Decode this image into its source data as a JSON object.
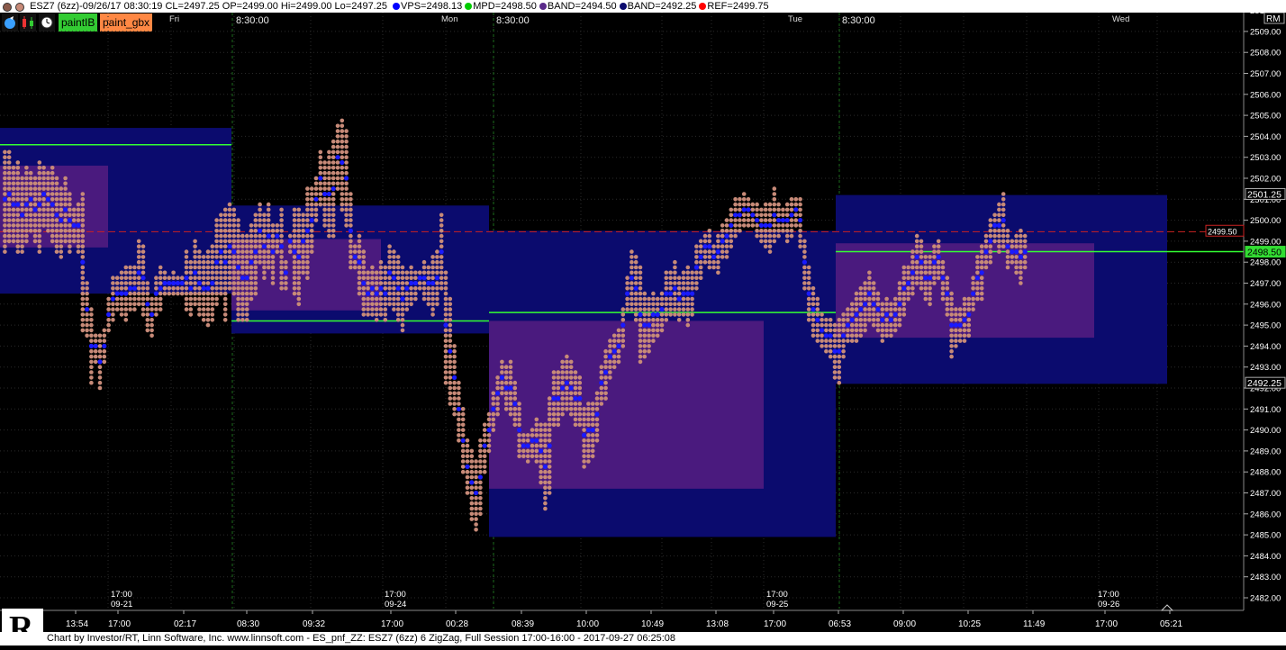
{
  "header": {
    "symbol_line": "ESZ7 (6zz)-09/26/17 08:30:19 CL=2497.25 OP=2499.00 Hi=2499.00 Lo=2497.25",
    "legend": [
      {
        "label": "VPS=2498.13",
        "color": "#0000ff"
      },
      {
        "label": "MPD=2498.50",
        "color": "#00cc00"
      },
      {
        "label": "BAND=2494.50",
        "color": "#5a2a8a"
      },
      {
        "label": "BAND=2492.25",
        "color": "#0b0b6e"
      },
      {
        "label": "REF=2499.75",
        "color": "#ff0000"
      }
    ]
  },
  "toolbar": {
    "paint_ib": "paintIB",
    "paint_gbx": "paint_gbx",
    "rm": "RM"
  },
  "footer": {
    "text": "Chart by Investor/RT, Linn Software, Inc. www.linnsoft.com - ES_pnf_ZZ: ESZ7 (6zz) 6 ZigZag, Full Session 17:00-16:00 - 2017-09-27 06:25:08"
  },
  "colors": {
    "dot": "#c78a78",
    "blue_dot": "#1a1aff",
    "band_outer": "#0b0b6e",
    "band_inner": "#4a1a7e",
    "mpd_line": "#33ff33",
    "ref_line": "#cc2222",
    "grid": "#2a2a2a",
    "session_line": "#1c6b1c"
  },
  "chart_data": {
    "type": "point-and-figure",
    "y_range": [
      2481.5,
      2510.5
    ],
    "y_ticks": [
      "2482.00",
      "2483.00",
      "2484.00",
      "2485.00",
      "2486.00",
      "2487.00",
      "2488.00",
      "2489.00",
      "2490.00",
      "2491.00",
      "2492.00",
      "2493.00",
      "2494.00",
      "2495.00",
      "2496.00",
      "2497.00",
      "2498.00",
      "2499.00",
      "2500.00",
      "2501.00",
      "2502.00",
      "2503.00",
      "2504.00",
      "2505.00",
      "2506.00",
      "2507.00",
      "2508.00",
      "2509.00",
      "2510.00"
    ],
    "price_markers": [
      {
        "label": "2501.25",
        "value": 2501.25,
        "style": "white"
      },
      {
        "label": "2499.50",
        "value": 2499.5,
        "style": "red"
      },
      {
        "label": "2498.50",
        "value": 2498.5,
        "style": "green"
      },
      {
        "label": "2492.25",
        "value": 2492.25,
        "style": "white"
      }
    ],
    "ref_line": 2499.45,
    "day_labels": [
      "Fri",
      "Mon",
      "Tue",
      "Wed"
    ],
    "session_times": [
      "8:30:00",
      "8:30:00",
      "8:30:00"
    ],
    "date_marks": [
      {
        "time": "17:00",
        "date": "09-21"
      },
      {
        "time": "17:00",
        "date": "09-24"
      },
      {
        "time": "17:00",
        "date": "09-25"
      },
      {
        "time": "17:00",
        "date": "09-26"
      }
    ],
    "x_ticks": [
      "13:54",
      "17:00",
      "02:17",
      "08:30",
      "09:32",
      "17:00",
      "00:28",
      "08:39",
      "10:00",
      "10:49",
      "13:08",
      "17:00",
      "06:53",
      "09:00",
      "10:25",
      "11:49",
      "17:00",
      "05:21"
    ],
    "bands": [
      {
        "session": 1,
        "outer": [
          2496.5,
          2504.4
        ],
        "inner": [
          2498.7,
          2502.6
        ],
        "mpd": 2503.6
      },
      {
        "session": 2,
        "outer": [
          2494.6,
          2500.7
        ],
        "inner": [
          2495.7,
          2499.1
        ],
        "mpd": 2495.2
      },
      {
        "session": 3,
        "outer": [
          2484.9,
          2499.5
        ],
        "inner": [
          2487.2,
          2495.2
        ],
        "mpd": 2495.6
      },
      {
        "session": 4,
        "outer": [
          2492.2,
          2501.2
        ],
        "inner": [
          2494.4,
          2498.9
        ],
        "mpd": 2498.5
      }
    ],
    "columns": [
      [
        2498.5,
        2503.25
      ],
      [
        2499,
        2503.25
      ],
      [
        2499,
        2502.5
      ],
      [
        2498.5,
        2502.75
      ],
      [
        2498.5,
        2502
      ],
      [
        2499,
        2502.5
      ],
      [
        2499.5,
        2502.25
      ],
      [
        2499,
        2502
      ],
      [
        2498.5,
        2502.75
      ],
      [
        2499.75,
        2502.5
      ],
      [
        2499.5,
        2502.25
      ],
      [
        2499,
        2502.5
      ],
      [
        2498.5,
        2502
      ],
      [
        2498.25,
        2501.5
      ],
      [
        2499,
        2502
      ],
      [
        2498.5,
        2501.25
      ],
      [
        2499,
        2500.5
      ],
      [
        2498.5,
        2500.75
      ],
      [
        2494.75,
        2501.25
      ],
      [
        2494.5,
        2497
      ],
      [
        2492.25,
        2495.75
      ],
      [
        2493.25,
        2494.5
      ],
      [
        2492,
        2494.5
      ],
      [
        2493.25,
        2494.75
      ],
      [
        2494.75,
        2496.25
      ],
      [
        2495.25,
        2497.25
      ],
      [
        2495.75,
        2497.25
      ],
      [
        2495.5,
        2497.5
      ],
      [
        2495.25,
        2497.75
      ],
      [
        2495.75,
        2497.75
      ],
      [
        2495.75,
        2497.75
      ],
      [
        2496,
        2499
      ],
      [
        2495.5,
        2498.75
      ],
      [
        2494.75,
        2497
      ],
      [
        2494.5,
        2496.25
      ],
      [
        2495.5,
        2497.25
      ],
      [
        2495.75,
        2497.75
      ],
      [
        2496.5,
        2497.5
      ],
      [
        2496.5,
        2497.25
      ],
      [
        2496.5,
        2497.5
      ],
      [
        2496.5,
        2497.25
      ],
      [
        2496.5,
        2497.25
      ],
      [
        2495.75,
        2498.5
      ],
      [
        2495.5,
        2498
      ],
      [
        2496,
        2499
      ],
      [
        2495.5,
        2498.5
      ],
      [
        2495.25,
        2498.25
      ],
      [
        2495,
        2498.5
      ],
      [
        2495.25,
        2498.75
      ],
      [
        2496,
        2500
      ],
      [
        2496.5,
        2500.25
      ],
      [
        2495.25,
        2500.5
      ],
      [
        2496.75,
        2500.75
      ],
      [
        2496.5,
        2500.5
      ],
      [
        2495.25,
        2500
      ],
      [
        2495.25,
        2499.25
      ],
      [
        2495.25,
        2499.25
      ],
      [
        2496.25,
        2499.75
      ],
      [
        2496.5,
        2500.25
      ],
      [
        2498,
        2500.75
      ],
      [
        2497.25,
        2500.25
      ],
      [
        2497.75,
        2500.75
      ],
      [
        2497,
        2499.75
      ],
      [
        2498.5,
        2499.75
      ],
      [
        2496.75,
        2500.5
      ],
      [
        2496.75,
        2498
      ],
      [
        2498.5,
        2499.25
      ],
      [
        2496.5,
        2500.5
      ],
      [
        2496,
        2500.5
      ],
      [
        2497.5,
        2500.25
      ],
      [
        2497.25,
        2501.5
      ],
      [
        2498.5,
        2501.5
      ],
      [
        2500,
        2502
      ],
      [
        2500.75,
        2503.25
      ],
      [
        2499.75,
        2502.75
      ],
      [
        2499.25,
        2503.25
      ],
      [
        2499.25,
        2503.75
      ],
      [
        2501.5,
        2504.5
      ],
      [
        2500.5,
        2504.75
      ],
      [
        2499.75,
        2504.25
      ],
      [
        2497.75,
        2501.25
      ],
      [
        2497.75,
        2498.75
      ],
      [
        2496.5,
        2499.25
      ],
      [
        2495.5,
        2498.5
      ],
      [
        2495.5,
        2497.5
      ],
      [
        2495.5,
        2497.75
      ],
      [
        2495.25,
        2497.5
      ],
      [
        2495.5,
        2498
      ],
      [
        2495.25,
        2497.75
      ],
      [
        2496,
        2498.75
      ],
      [
        2495.75,
        2498.5
      ],
      [
        2495.25,
        2498.25
      ],
      [
        2494.75,
        2497.75
      ],
      [
        2495.75,
        2497.5
      ],
      [
        2496,
        2497.75
      ],
      [
        2496.25,
        2497.5
      ],
      [
        2496.75,
        2497.5
      ],
      [
        2496.25,
        2498
      ],
      [
        2496,
        2497.75
      ],
      [
        2495.5,
        2498.25
      ],
      [
        2496,
        2498.5
      ],
      [
        2496.75,
        2500.25
      ],
      [
        2492.25,
        2497.5
      ],
      [
        2491.25,
        2496.25
      ],
      [
        2490.75,
        2494
      ],
      [
        2489.5,
        2492.25
      ],
      [
        2488,
        2491
      ],
      [
        2487,
        2489.5
      ],
      [
        2485.75,
        2489
      ],
      [
        2485.25,
        2488.5
      ],
      [
        2486,
        2489.5
      ],
      [
        2488,
        2490.25
      ],
      [
        2489,
        2490.75
      ],
      [
        2490,
        2491.75
      ],
      [
        2490.75,
        2492.5
      ],
      [
        2491.75,
        2493.25
      ],
      [
        2491,
        2493
      ],
      [
        2490.75,
        2493.25
      ],
      [
        2490.25,
        2492.25
      ],
      [
        2488.75,
        2491.25
      ],
      [
        2488.75,
        2489.75
      ],
      [
        2488.5,
        2489.75
      ],
      [
        2488.75,
        2490
      ],
      [
        2488.5,
        2490.5
      ],
      [
        2487.5,
        2490.25
      ],
      [
        2486.25,
        2490.25
      ],
      [
        2487,
        2491.5
      ],
      [
        2490.25,
        2492.75
      ],
      [
        2490.25,
        2492.75
      ],
      [
        2490.75,
        2493.25
      ],
      [
        2491,
        2493.5
      ],
      [
        2490.75,
        2493.25
      ],
      [
        2490.25,
        2492.75
      ],
      [
        2490.25,
        2492.5
      ],
      [
        2488.25,
        2491
      ],
      [
        2488.5,
        2491.25
      ],
      [
        2488.75,
        2491.25
      ],
      [
        2489.5,
        2491.75
      ],
      [
        2491.25,
        2493
      ],
      [
        2491.5,
        2493.75
      ],
      [
        2492.5,
        2494.25
      ],
      [
        2493,
        2494.5
      ],
      [
        2493.25,
        2494.75
      ],
      [
        2494,
        2495.75
      ],
      [
        2495.75,
        2497.25
      ],
      [
        2495.75,
        2498.5
      ],
      [
        2495.25,
        2498.25
      ],
      [
        2493.25,
        2497.75
      ],
      [
        2493.5,
        2496.5
      ],
      [
        2493.75,
        2496.25
      ],
      [
        2494.25,
        2496.5
      ],
      [
        2494.5,
        2496.25
      ],
      [
        2494.75,
        2496.5
      ],
      [
        2495.25,
        2497.5
      ],
      [
        2495.5,
        2497.5
      ],
      [
        2495.5,
        2498
      ],
      [
        2495.25,
        2497.25
      ],
      [
        2495.5,
        2497.5
      ],
      [
        2495,
        2497.75
      ],
      [
        2495.5,
        2497.5
      ],
      [
        2496.75,
        2498.75
      ],
      [
        2497.25,
        2499
      ],
      [
        2498,
        2499.25
      ],
      [
        2497.75,
        2499.5
      ],
      [
        2497.75,
        2498.75
      ],
      [
        2497.5,
        2499.25
      ],
      [
        2498.25,
        2499.75
      ],
      [
        2498.25,
        2500
      ],
      [
        2498.75,
        2500.5
      ],
      [
        2499.25,
        2501
      ],
      [
        2499.5,
        2501
      ],
      [
        2499.75,
        2501.25
      ],
      [
        2499.75,
        2501
      ],
      [
        2499.75,
        2500.75
      ],
      [
        2499.25,
        2500.75
      ],
      [
        2499,
        2500.5
      ],
      [
        2498.75,
        2500.75
      ],
      [
        2498.5,
        2500.75
      ],
      [
        2499,
        2501.5
      ],
      [
        2499.25,
        2500.75
      ],
      [
        2499.5,
        2500.5
      ],
      [
        2499,
        2500.75
      ],
      [
        2499.25,
        2501
      ],
      [
        2499.75,
        2501
      ],
      [
        2498.75,
        2501
      ],
      [
        2496.75,
        2499
      ],
      [
        2495.25,
        2497.75
      ],
      [
        2494.5,
        2496.75
      ],
      [
        2494.25,
        2496.25
      ],
      [
        2494,
        2495.5
      ],
      [
        2493.75,
        2495.25
      ],
      [
        2493.5,
        2495.25
      ],
      [
        2492.5,
        2495
      ],
      [
        2492.25,
        2495.25
      ],
      [
        2493.5,
        2495.5
      ],
      [
        2494.25,
        2495.75
      ],
      [
        2494.25,
        2496
      ],
      [
        2494.25,
        2496.5
      ],
      [
        2494.5,
        2496.75
      ],
      [
        2494.75,
        2497
      ],
      [
        2495.25,
        2497.5
      ],
      [
        2495,
        2497
      ],
      [
        2494.75,
        2496.5
      ],
      [
        2494.25,
        2496
      ],
      [
        2494.5,
        2496.25
      ],
      [
        2494.5,
        2496
      ],
      [
        2494.75,
        2496.25
      ],
      [
        2495,
        2497
      ],
      [
        2495.5,
        2497.75
      ],
      [
        2496.25,
        2497.75
      ],
      [
        2496.5,
        2498.5
      ],
      [
        2497,
        2499.25
      ],
      [
        2496.75,
        2499
      ],
      [
        2496.25,
        2498.25
      ],
      [
        2496,
        2498.25
      ],
      [
        2497,
        2498.75
      ],
      [
        2497.25,
        2499
      ],
      [
        2496.25,
        2498
      ],
      [
        2495.5,
        2497.25
      ],
      [
        2493.5,
        2496.5
      ],
      [
        2494,
        2495.75
      ],
      [
        2494.25,
        2495.75
      ],
      [
        2494.25,
        2496.25
      ],
      [
        2494.5,
        2496.25
      ],
      [
        2495.75,
        2497.25
      ],
      [
        2496.25,
        2498.25
      ],
      [
        2496.25,
        2498.75
      ],
      [
        2497.75,
        2499.25
      ],
      [
        2498,
        2500
      ],
      [
        2499,
        2500.25
      ],
      [
        2498.5,
        2500.75
      ],
      [
        2498.75,
        2501.25
      ],
      [
        2497.75,
        2499.5
      ],
      [
        2498,
        2499
      ],
      [
        2497.5,
        2499.25
      ],
      [
        2497,
        2499.5
      ],
      [
        2497.75,
        2499.25
      ]
    ]
  }
}
